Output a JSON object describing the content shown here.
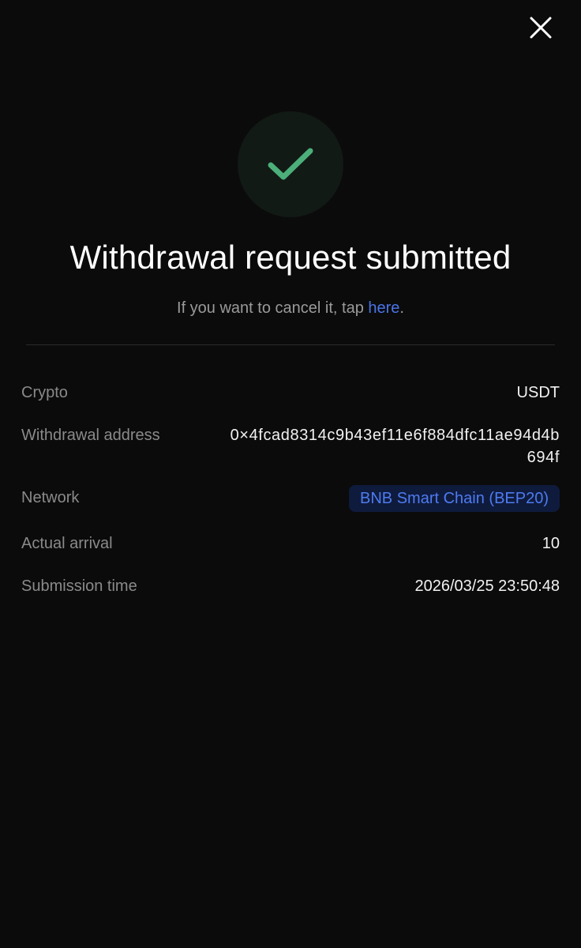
{
  "header": {
    "close_icon": "close-icon"
  },
  "status": {
    "icon": "checkmark-icon",
    "accent_color": "#4caf7a",
    "title": "Withdrawal request submitted",
    "cancel_prefix": "If you want to cancel it, tap ",
    "cancel_link": "here",
    "cancel_suffix": "."
  },
  "details": {
    "crypto_label": "Crypto",
    "crypto_value": "USDT",
    "address_label": "Withdrawal address",
    "address_value": "0×4fcad8314c9b43ef11e6f884dfc11ae94d4b694f",
    "network_label": "Network",
    "network_value": "BNB Smart Chain (BEP20)",
    "arrival_label": "Actual arrival",
    "arrival_value": "10",
    "time_label": "Submission time",
    "time_value": "2026/03/25 23:50:48"
  },
  "colors": {
    "background": "#0b0b0b",
    "link": "#4a74e8",
    "badge_bg": "#0f1b3d",
    "badge_text": "#4d7bf0"
  }
}
